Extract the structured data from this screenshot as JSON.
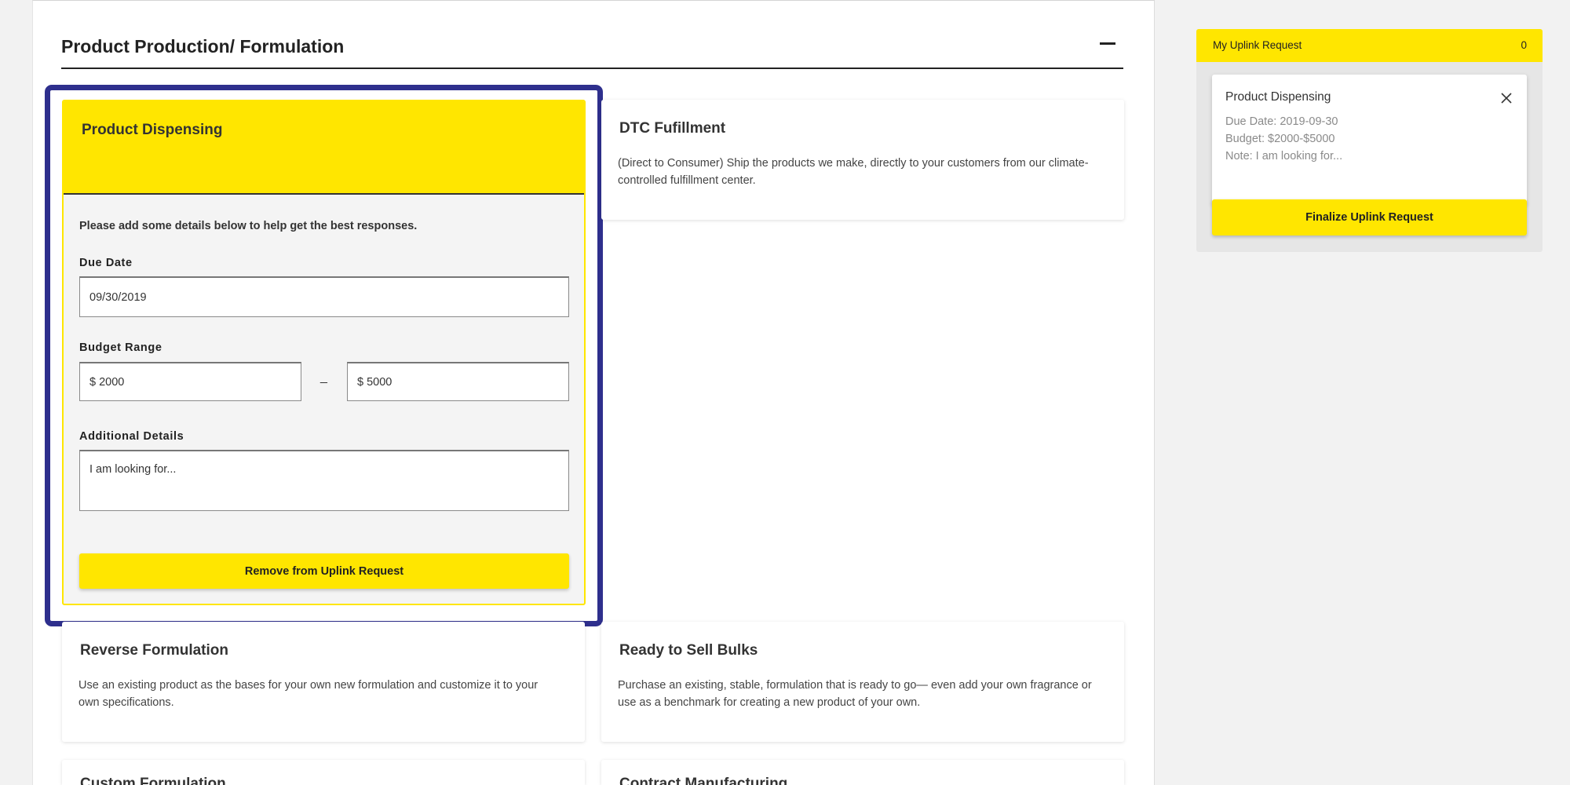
{
  "section": {
    "title": "Product Production/ Formulation"
  },
  "expanded_card": {
    "title": "Product Dispensing",
    "helper": "Please add some details below to help get the best responses.",
    "due_date_label": "Due Date",
    "due_date_value": "09/30/2019",
    "budget_label": "Budget Range",
    "budget_min": "$ 2000",
    "budget_separator": "_",
    "budget_max": "$ 5000",
    "details_label": "Additional Details",
    "details_value": "I am looking for...",
    "remove_button": "Remove from Uplink Request"
  },
  "cards": [
    {
      "title": "DTC Fufillment",
      "description": "(Direct to Consumer) Ship the products we make, directly to your customers from our climate-controlled fulfillment center."
    },
    {
      "title": "Reverse Formulation",
      "description": "Use an existing product as the bases for your own new formulation and customize it to your own specifications."
    },
    {
      "title": "Ready to Sell Bulks",
      "description": "Purchase an existing, stable, formulation that is ready to go— even add your own fragrance or use as a benchmark for creating a new product of your own."
    },
    {
      "title": "Custom Formulation",
      "description": ""
    },
    {
      "title": "Contract Manufacturing",
      "description": ""
    }
  ],
  "uplink": {
    "title": "My Uplink Request",
    "count": "0",
    "item": {
      "title": "Product Dispensing",
      "due_date": "Due Date: 2019-09-30",
      "budget": "Budget: $2000-$5000",
      "note": "Note: I am looking for..."
    },
    "finalize_button": "Finalize Uplink Request"
  },
  "colors": {
    "accent_yellow": "#ffe600",
    "highlight_frame": "#2e2f8d"
  }
}
